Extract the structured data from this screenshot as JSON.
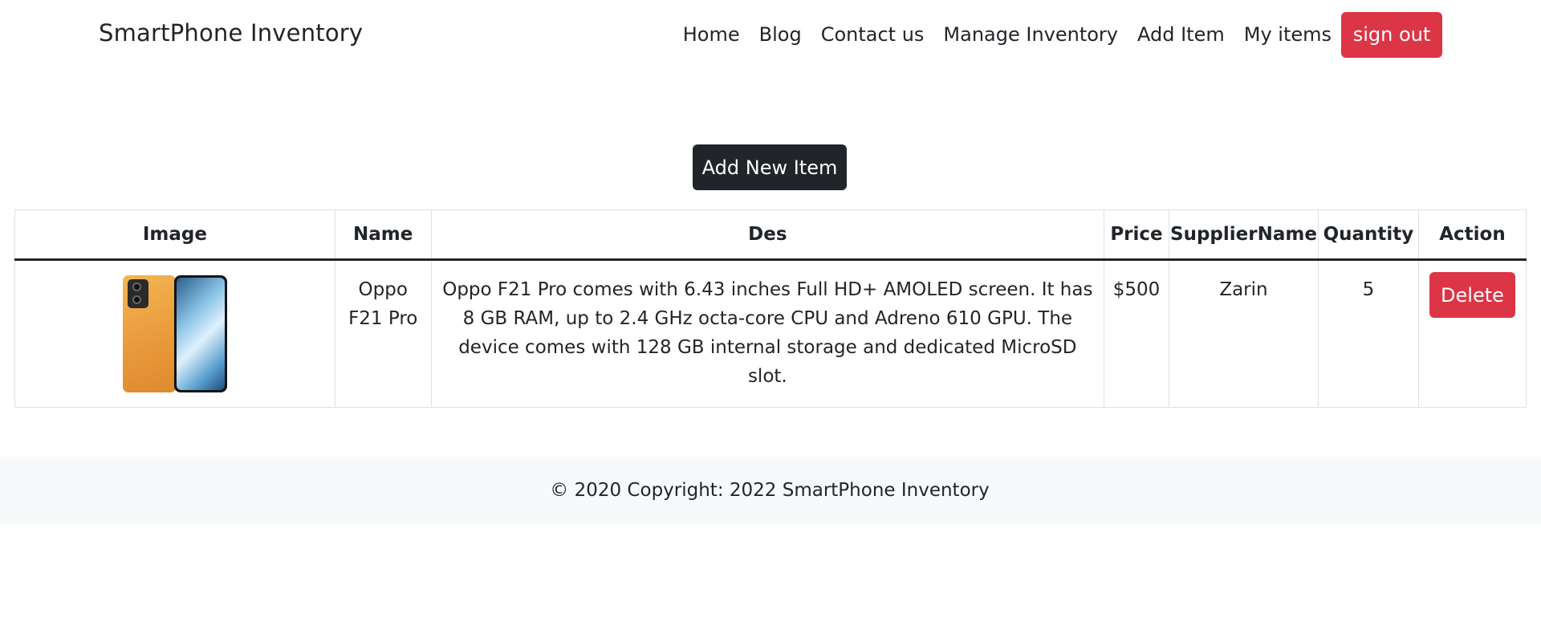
{
  "navbar": {
    "brand": "SmartPhone Inventory",
    "links": [
      "Home",
      "Blog",
      "Contact us",
      "Manage Inventory",
      "Add Item",
      "My items"
    ],
    "signout_label": "sign out",
    "signout_color": "#dc3545"
  },
  "main": {
    "add_button_label": "Add New Item"
  },
  "table": {
    "headers": [
      "Image",
      "Name",
      "Des",
      "Price",
      "SupplierName",
      "Quantity",
      "Action"
    ],
    "rows": [
      {
        "image_icon": "phone-image",
        "name": "Oppo F21 Pro",
        "des": "Oppo F21 Pro comes with 6.43 inches Full HD+ AMOLED screen. It has 8 GB RAM, up to 2.4 GHz octa-core CPU and Adreno 610 GPU. The device comes with 128 GB internal storage and dedicated MicroSD slot.",
        "price": "$500",
        "supplier": "Zarin",
        "quantity": "5",
        "action_label": "Delete"
      }
    ]
  },
  "footer": {
    "text": "© 2020 Copyright: 2022 SmartPhone Inventory"
  },
  "colors": {
    "danger": "#dc3545",
    "dark": "#212529",
    "footer_bg": "#f8f9fa"
  }
}
